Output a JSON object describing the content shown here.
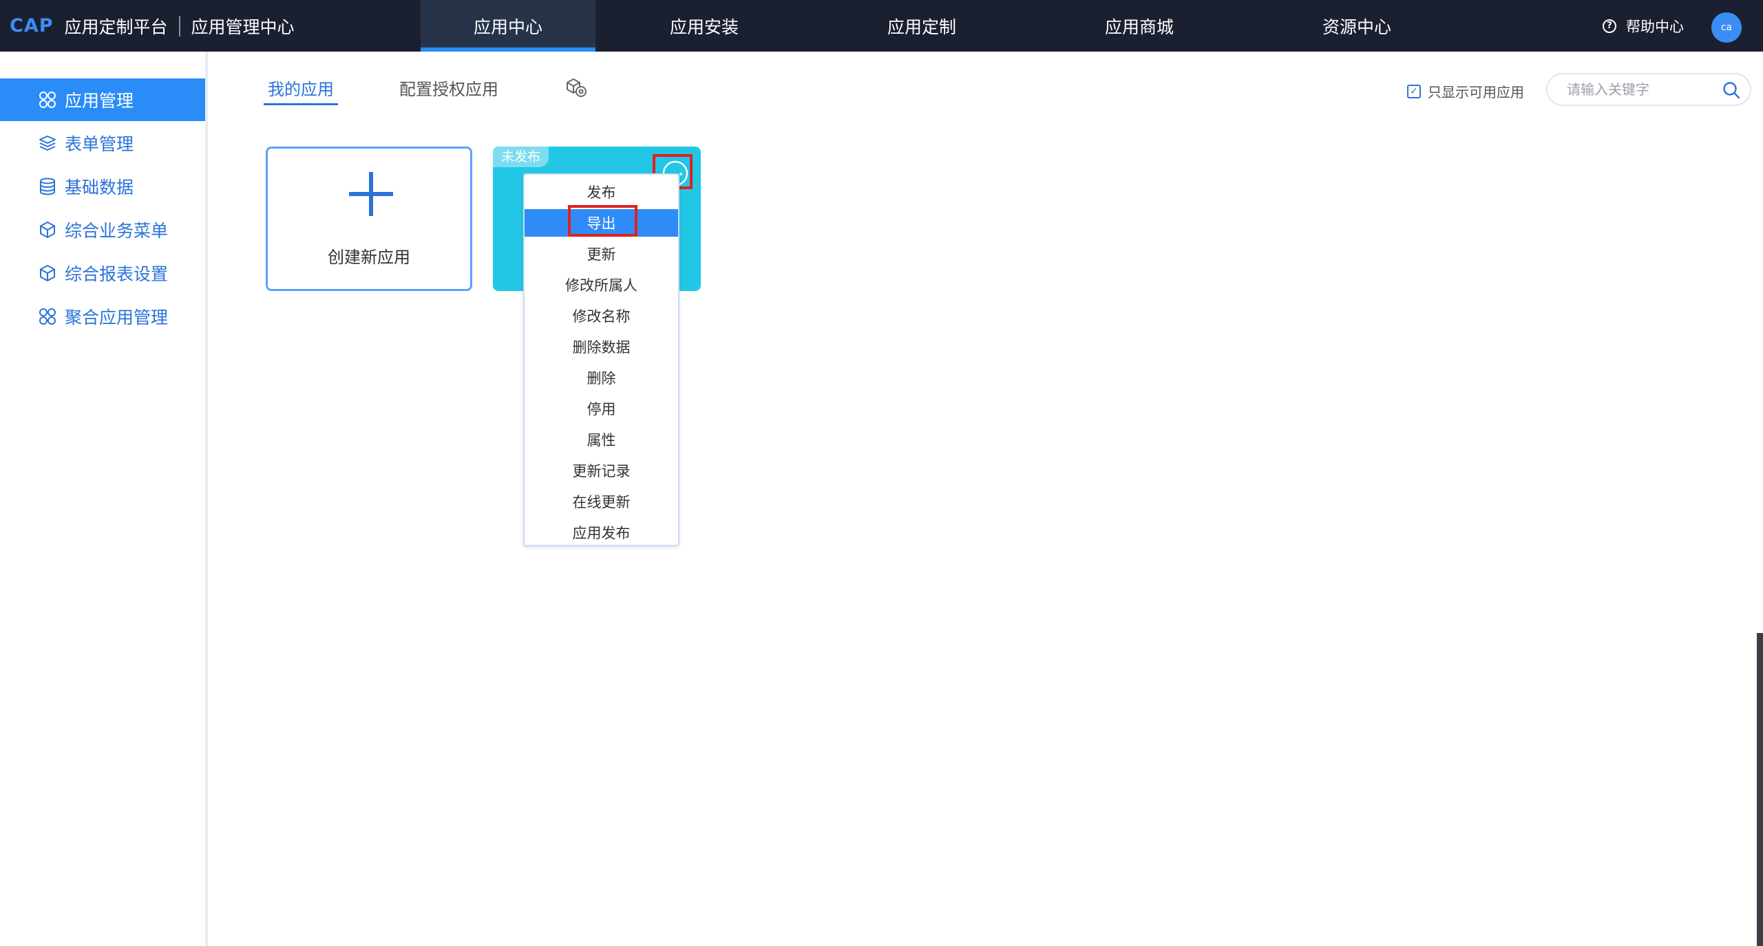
{
  "header": {
    "logo": "CAP",
    "platform_name": "应用定制平台",
    "subtitle": "应用管理中心",
    "nav": [
      {
        "label": "应用中心"
      },
      {
        "label": "应用安装"
      },
      {
        "label": "应用定制"
      },
      {
        "label": "应用商城"
      },
      {
        "label": "资源中心"
      }
    ],
    "help_label": "帮助中心",
    "avatar_text": "ca"
  },
  "sidebar": {
    "items": [
      {
        "label": "应用管理",
        "icon": "apps-icon"
      },
      {
        "label": "表单管理",
        "icon": "layers-icon"
      },
      {
        "label": "基础数据",
        "icon": "database-icon"
      },
      {
        "label": "综合业务菜单",
        "icon": "cube-icon"
      },
      {
        "label": "综合报表设置",
        "icon": "cube-icon"
      },
      {
        "label": "聚合应用管理",
        "icon": "apps-icon"
      }
    ]
  },
  "tabs": [
    {
      "label": "我的应用"
    },
    {
      "label": "配置授权应用"
    }
  ],
  "filter": {
    "label": "只显示可用应用",
    "checked": true
  },
  "search": {
    "placeholder": "请输入关键字"
  },
  "create_card": {
    "label": "创建新应用"
  },
  "app_card": {
    "status": "未发布"
  },
  "menu": {
    "items": [
      {
        "label": "发布"
      },
      {
        "label": "导出"
      },
      {
        "label": "更新"
      },
      {
        "label": "修改所属人"
      },
      {
        "label": "修改名称"
      },
      {
        "label": "删除数据"
      },
      {
        "label": "删除"
      },
      {
        "label": "停用"
      },
      {
        "label": "属性"
      },
      {
        "label": "更新记录"
      },
      {
        "label": "在线更新"
      },
      {
        "label": "应用发布"
      }
    ]
  },
  "colors": {
    "topbar": "#1b2030",
    "accent": "#2a8cf7",
    "card": "#23c7e6",
    "highlight": "#e02020"
  }
}
